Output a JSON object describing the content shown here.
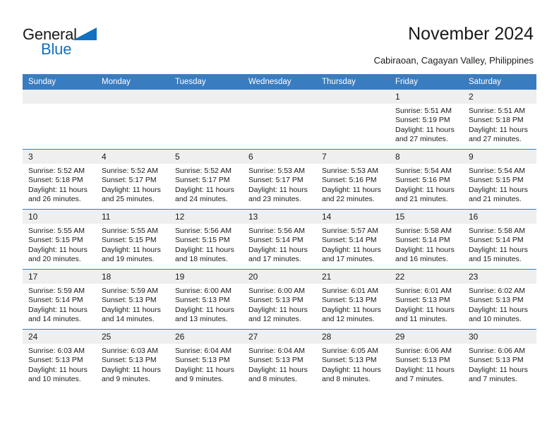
{
  "brand": {
    "logo_text_primary": "General",
    "logo_text_secondary": "Blue",
    "logo_triangle_color": "#1271c0",
    "accent_color": "#3a7cc0"
  },
  "header": {
    "title": "November 2024",
    "subtitle": "Cabiraoan, Cagayan Valley, Philippines"
  },
  "calendar": {
    "weekday_headers": [
      "Sunday",
      "Monday",
      "Tuesday",
      "Wednesday",
      "Thursday",
      "Friday",
      "Saturday"
    ],
    "header_bg": "#3a7cc0",
    "daynum_bg": "#efefef",
    "weeks": [
      [
        {
          "day": "",
          "blank": true
        },
        {
          "day": "",
          "blank": true
        },
        {
          "day": "",
          "blank": true
        },
        {
          "day": "",
          "blank": true
        },
        {
          "day": "",
          "blank": true
        },
        {
          "day": "1",
          "sunrise": "Sunrise: 5:51 AM",
          "sunset": "Sunset: 5:19 PM",
          "daylight": "Daylight: 11 hours and 27 minutes."
        },
        {
          "day": "2",
          "sunrise": "Sunrise: 5:51 AM",
          "sunset": "Sunset: 5:18 PM",
          "daylight": "Daylight: 11 hours and 27 minutes."
        }
      ],
      [
        {
          "day": "3",
          "sunrise": "Sunrise: 5:52 AM",
          "sunset": "Sunset: 5:18 PM",
          "daylight": "Daylight: 11 hours and 26 minutes."
        },
        {
          "day": "4",
          "sunrise": "Sunrise: 5:52 AM",
          "sunset": "Sunset: 5:17 PM",
          "daylight": "Daylight: 11 hours and 25 minutes."
        },
        {
          "day": "5",
          "sunrise": "Sunrise: 5:52 AM",
          "sunset": "Sunset: 5:17 PM",
          "daylight": "Daylight: 11 hours and 24 minutes."
        },
        {
          "day": "6",
          "sunrise": "Sunrise: 5:53 AM",
          "sunset": "Sunset: 5:17 PM",
          "daylight": "Daylight: 11 hours and 23 minutes."
        },
        {
          "day": "7",
          "sunrise": "Sunrise: 5:53 AM",
          "sunset": "Sunset: 5:16 PM",
          "daylight": "Daylight: 11 hours and 22 minutes."
        },
        {
          "day": "8",
          "sunrise": "Sunrise: 5:54 AM",
          "sunset": "Sunset: 5:16 PM",
          "daylight": "Daylight: 11 hours and 21 minutes."
        },
        {
          "day": "9",
          "sunrise": "Sunrise: 5:54 AM",
          "sunset": "Sunset: 5:15 PM",
          "daylight": "Daylight: 11 hours and 21 minutes."
        }
      ],
      [
        {
          "day": "10",
          "sunrise": "Sunrise: 5:55 AM",
          "sunset": "Sunset: 5:15 PM",
          "daylight": "Daylight: 11 hours and 20 minutes."
        },
        {
          "day": "11",
          "sunrise": "Sunrise: 5:55 AM",
          "sunset": "Sunset: 5:15 PM",
          "daylight": "Daylight: 11 hours and 19 minutes."
        },
        {
          "day": "12",
          "sunrise": "Sunrise: 5:56 AM",
          "sunset": "Sunset: 5:15 PM",
          "daylight": "Daylight: 11 hours and 18 minutes."
        },
        {
          "day": "13",
          "sunrise": "Sunrise: 5:56 AM",
          "sunset": "Sunset: 5:14 PM",
          "daylight": "Daylight: 11 hours and 17 minutes."
        },
        {
          "day": "14",
          "sunrise": "Sunrise: 5:57 AM",
          "sunset": "Sunset: 5:14 PM",
          "daylight": "Daylight: 11 hours and 17 minutes."
        },
        {
          "day": "15",
          "sunrise": "Sunrise: 5:58 AM",
          "sunset": "Sunset: 5:14 PM",
          "daylight": "Daylight: 11 hours and 16 minutes."
        },
        {
          "day": "16",
          "sunrise": "Sunrise: 5:58 AM",
          "sunset": "Sunset: 5:14 PM",
          "daylight": "Daylight: 11 hours and 15 minutes."
        }
      ],
      [
        {
          "day": "17",
          "sunrise": "Sunrise: 5:59 AM",
          "sunset": "Sunset: 5:14 PM",
          "daylight": "Daylight: 11 hours and 14 minutes."
        },
        {
          "day": "18",
          "sunrise": "Sunrise: 5:59 AM",
          "sunset": "Sunset: 5:13 PM",
          "daylight": "Daylight: 11 hours and 14 minutes."
        },
        {
          "day": "19",
          "sunrise": "Sunrise: 6:00 AM",
          "sunset": "Sunset: 5:13 PM",
          "daylight": "Daylight: 11 hours and 13 minutes."
        },
        {
          "day": "20",
          "sunrise": "Sunrise: 6:00 AM",
          "sunset": "Sunset: 5:13 PM",
          "daylight": "Daylight: 11 hours and 12 minutes."
        },
        {
          "day": "21",
          "sunrise": "Sunrise: 6:01 AM",
          "sunset": "Sunset: 5:13 PM",
          "daylight": "Daylight: 11 hours and 12 minutes."
        },
        {
          "day": "22",
          "sunrise": "Sunrise: 6:01 AM",
          "sunset": "Sunset: 5:13 PM",
          "daylight": "Daylight: 11 hours and 11 minutes."
        },
        {
          "day": "23",
          "sunrise": "Sunrise: 6:02 AM",
          "sunset": "Sunset: 5:13 PM",
          "daylight": "Daylight: 11 hours and 10 minutes."
        }
      ],
      [
        {
          "day": "24",
          "sunrise": "Sunrise: 6:03 AM",
          "sunset": "Sunset: 5:13 PM",
          "daylight": "Daylight: 11 hours and 10 minutes."
        },
        {
          "day": "25",
          "sunrise": "Sunrise: 6:03 AM",
          "sunset": "Sunset: 5:13 PM",
          "daylight": "Daylight: 11 hours and 9 minutes."
        },
        {
          "day": "26",
          "sunrise": "Sunrise: 6:04 AM",
          "sunset": "Sunset: 5:13 PM",
          "daylight": "Daylight: 11 hours and 9 minutes."
        },
        {
          "day": "27",
          "sunrise": "Sunrise: 6:04 AM",
          "sunset": "Sunset: 5:13 PM",
          "daylight": "Daylight: 11 hours and 8 minutes."
        },
        {
          "day": "28",
          "sunrise": "Sunrise: 6:05 AM",
          "sunset": "Sunset: 5:13 PM",
          "daylight": "Daylight: 11 hours and 8 minutes."
        },
        {
          "day": "29",
          "sunrise": "Sunrise: 6:06 AM",
          "sunset": "Sunset: 5:13 PM",
          "daylight": "Daylight: 11 hours and 7 minutes."
        },
        {
          "day": "30",
          "sunrise": "Sunrise: 6:06 AM",
          "sunset": "Sunset: 5:13 PM",
          "daylight": "Daylight: 11 hours and 7 minutes."
        }
      ]
    ]
  }
}
